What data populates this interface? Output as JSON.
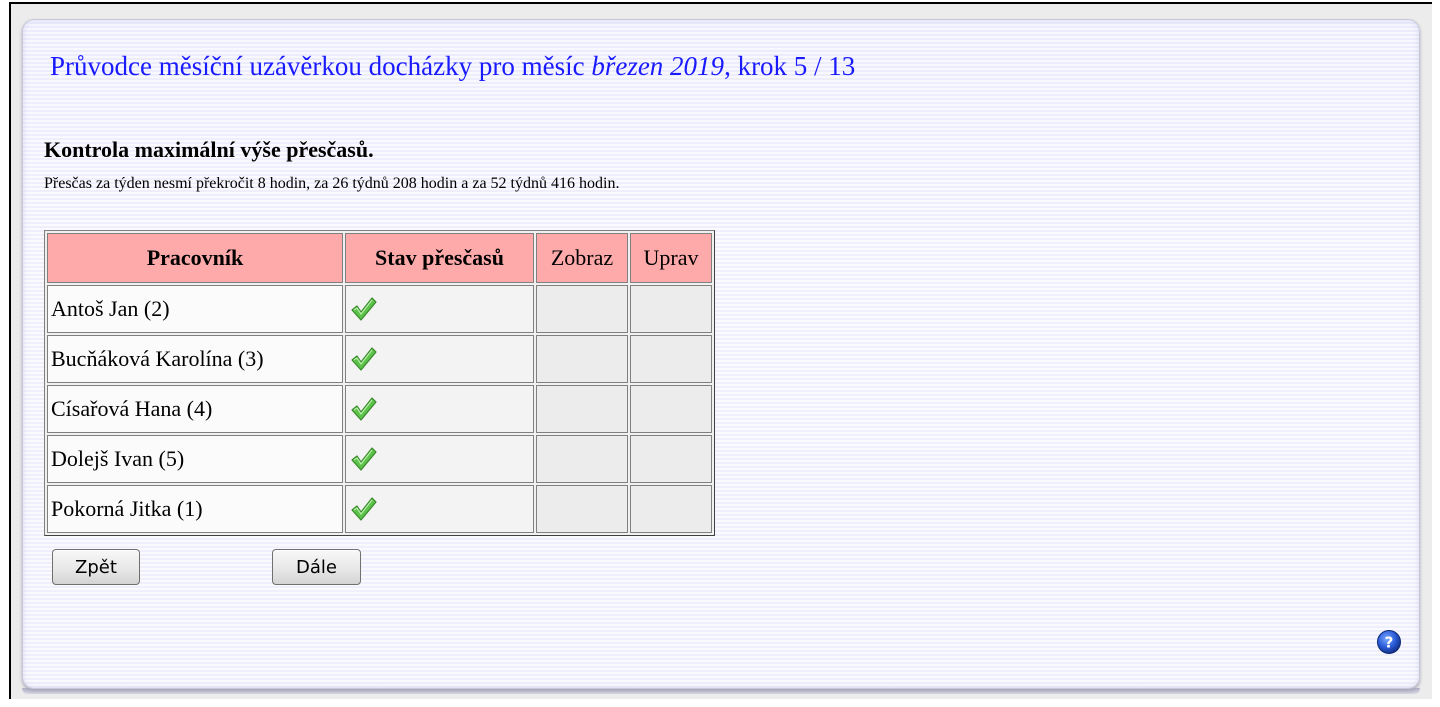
{
  "wizard": {
    "title_prefix": "Průvodce měsíční uzávěrkou docházky pro měsíc ",
    "month": "březen 2019",
    "title_suffix": ", krok 5 / 13"
  },
  "section": {
    "heading": "Kontrola maximální výše přesčasů.",
    "description": "Přesčas za týden nesmí překročit 8 hodin, za 26 týdnů 208 hodin a za 52 týdnů 416 hodin."
  },
  "table": {
    "headers": {
      "employee": "Pracovník",
      "overtime_status": "Stav přesčasů",
      "show": "Zobraz",
      "edit": "Uprav"
    },
    "rows": [
      {
        "employee": "Antoš Jan (2)",
        "status_icon": "check-icon",
        "show": "",
        "edit": ""
      },
      {
        "employee": "Bucňáková Karolína (3)",
        "status_icon": "check-icon",
        "show": "",
        "edit": ""
      },
      {
        "employee": "Císařová Hana (4)",
        "status_icon": "check-icon",
        "show": "",
        "edit": ""
      },
      {
        "employee": "Dolejš Ivan (5)",
        "status_icon": "check-icon",
        "show": "",
        "edit": ""
      },
      {
        "employee": "Pokorná Jitka (1)",
        "status_icon": "check-icon",
        "show": "",
        "edit": ""
      }
    ]
  },
  "buttons": {
    "back_label": "Zpět",
    "next_label": "Dále"
  },
  "help": {
    "icon": "help-icon"
  },
  "colors": {
    "title": "#1a1aff",
    "header_bg": "#ffaaaa",
    "check": "#5cc24a"
  }
}
